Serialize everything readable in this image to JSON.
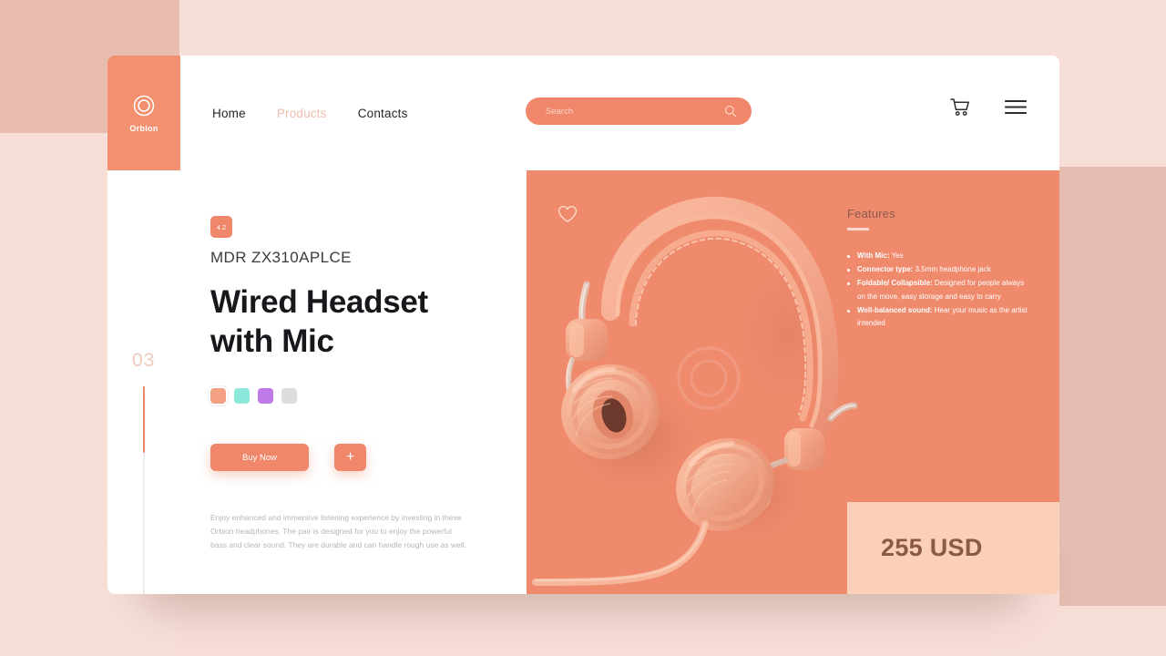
{
  "brand": {
    "name": "Orbion",
    "logo_icon": "ring-logo-icon",
    "accent": "#f0866a",
    "panel": "#f08a6d"
  },
  "nav": {
    "items": [
      {
        "label": "Home",
        "active": false
      },
      {
        "label": "Products",
        "active": true
      },
      {
        "label": "Contacts",
        "active": false
      }
    ]
  },
  "search": {
    "placeholder": "Search",
    "value": "",
    "icon": "search-icon"
  },
  "header_actions": {
    "cart_icon": "shopping-cart-icon",
    "menu_icon": "hamburger-menu-icon"
  },
  "product": {
    "rating_badge": "4.2",
    "model_code": "MDR ZX310APLCE",
    "title": "Wired Headset with Mic",
    "slide_index": "03",
    "description": "Enjoy enhanced and immersive listening experience by investing in these Orbion headphones. The pair is designed for you to enjoy the powerful bass and clear sound. They are durable and can handle rough use as well.",
    "colors": [
      {
        "name": "peach",
        "hex": "#f4a183",
        "selected": true
      },
      {
        "name": "mint",
        "hex": "#8de8dc",
        "selected": false
      },
      {
        "name": "purple",
        "hex": "#bf7ae8",
        "selected": false
      },
      {
        "name": "gray",
        "hex": "#dddddd",
        "selected": false
      }
    ],
    "buy_label": "Buy Now",
    "add_label": "+",
    "wishlist_icon": "heart-icon",
    "price": "255 USD"
  },
  "features": {
    "title": "Features",
    "items": [
      {
        "label": "With Mic:",
        "text": " Yes"
      },
      {
        "label": "Connector type:",
        "text": " 3.5mm headphone jack"
      },
      {
        "label": "Foldable/ Collapsible:",
        "text": " Designed for people always on the move, easy storage and easy to carry"
      },
      {
        "label": "Well-balanced sound:",
        "text": " Hear your music as the artist intended"
      }
    ]
  }
}
